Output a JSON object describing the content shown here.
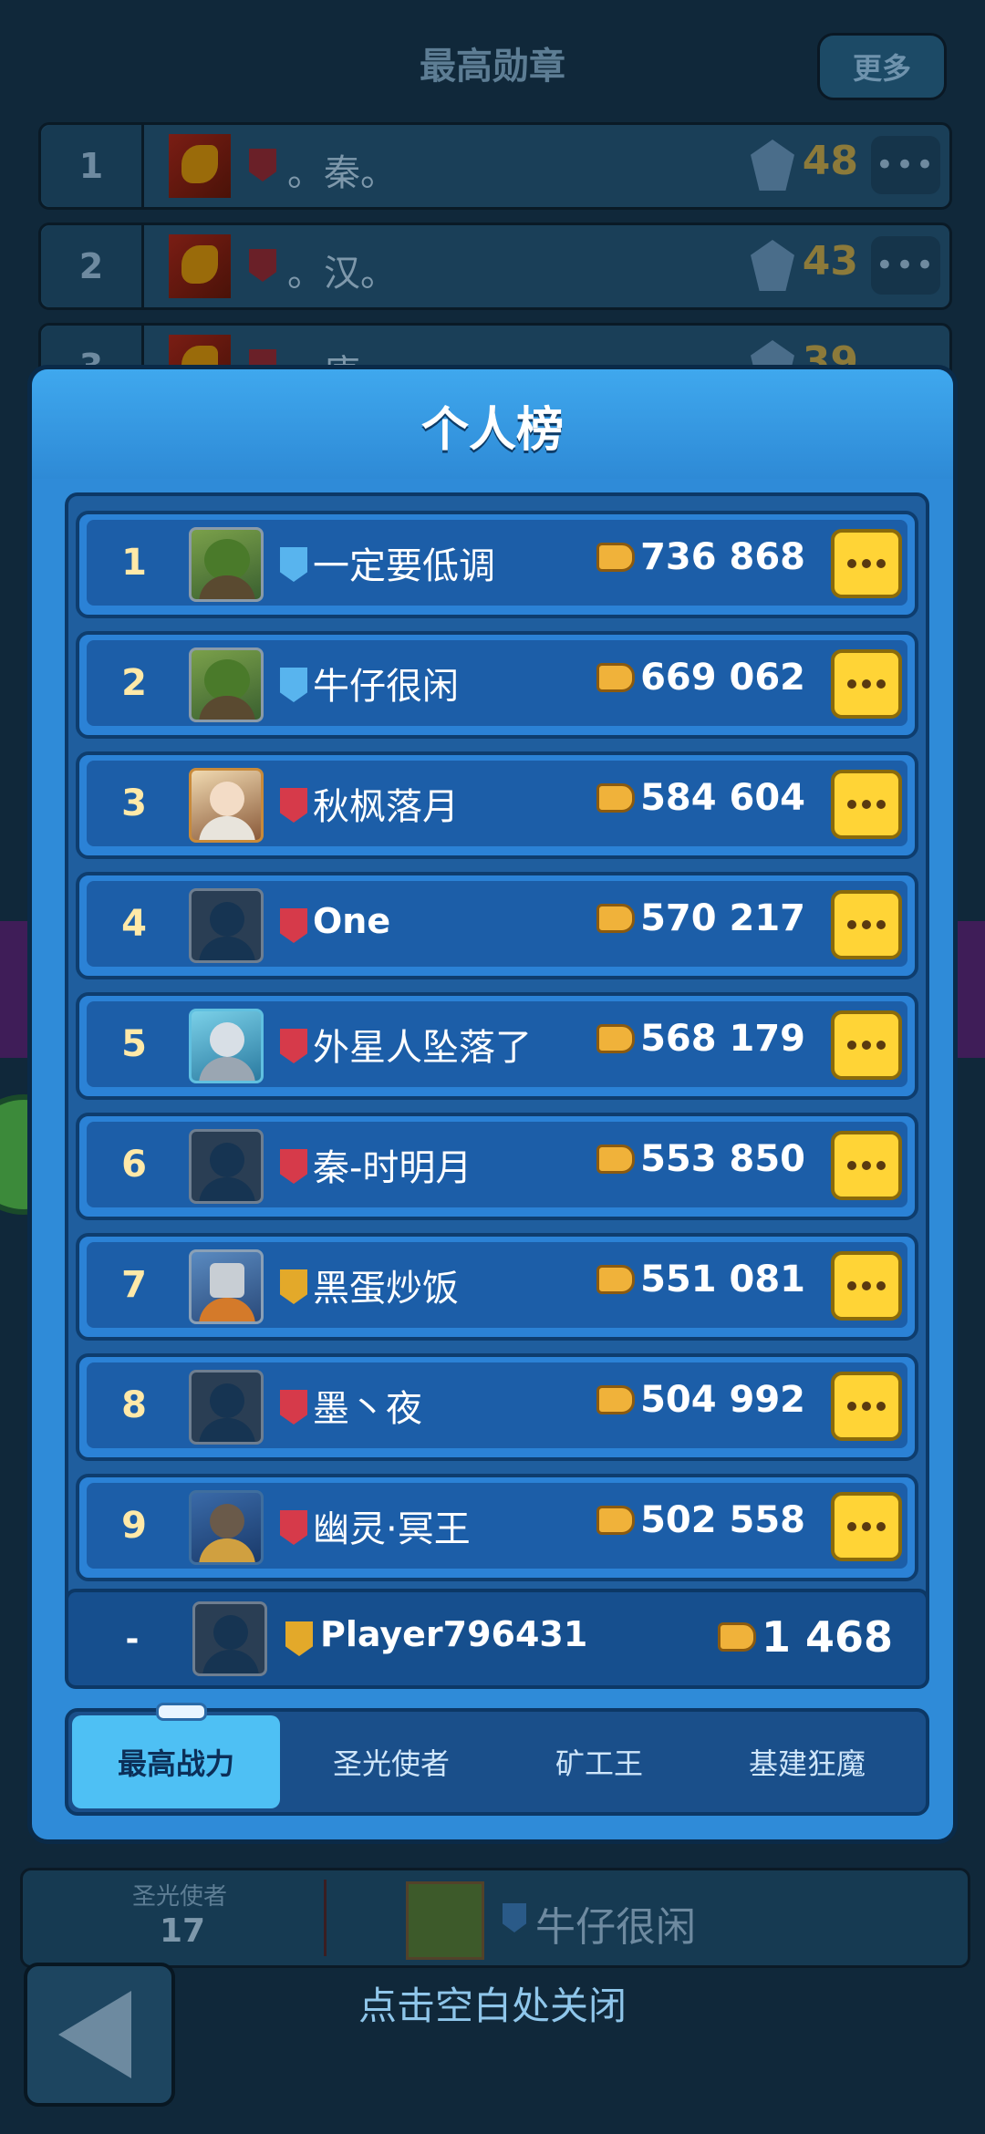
{
  "background": {
    "title": "最高勋章",
    "more_label": "更多",
    "rows": [
      {
        "rank": "1",
        "name": "。秦。",
        "score": "48"
      },
      {
        "rank": "2",
        "name": "。汉。",
        "score": "43"
      },
      {
        "rank": "3",
        "name": "。唐。",
        "score": "39"
      }
    ],
    "bottom_card": {
      "label": "圣光使者",
      "value": "17",
      "name": "牛仔很闲"
    },
    "close_hint": "点击空白处关闭"
  },
  "modal": {
    "title": "个人榜",
    "players": [
      {
        "rank": "1",
        "name": "一定要低调",
        "clan": "blue",
        "power": "736 868",
        "avatar": "goblin"
      },
      {
        "rank": "2",
        "name": "牛仔很闲",
        "clan": "blue",
        "power": "669 062",
        "avatar": "goblin"
      },
      {
        "rank": "3",
        "name": "秋枫落月",
        "clan": "red",
        "power": "584 604",
        "avatar": "girl"
      },
      {
        "rank": "4",
        "name": "One",
        "clan": "red",
        "power": "570 217",
        "avatar": "default"
      },
      {
        "rank": "5",
        "name": "外星人坠落了",
        "clan": "red",
        "power": "568 179",
        "avatar": "robot"
      },
      {
        "rank": "6",
        "name": "秦-时明月",
        "clan": "red",
        "power": "553 850",
        "avatar": "default"
      },
      {
        "rank": "7",
        "name": "黑蛋炒饭",
        "clan": "gold",
        "power": "551 081",
        "avatar": "hammer"
      },
      {
        "rank": "8",
        "name": "墨丶夜",
        "clan": "red",
        "power": "504 992",
        "avatar": "default"
      },
      {
        "rank": "9",
        "name": "幽灵·冥王",
        "clan": "red",
        "power": "502 558",
        "avatar": "wolf"
      }
    ],
    "my_row": {
      "rank": "-",
      "name": "Player796431",
      "clan": "gold",
      "power": "1 468"
    },
    "tabs": [
      {
        "label": "最高战力",
        "active": true
      },
      {
        "label": "圣光使者",
        "active": false
      },
      {
        "label": "矿工王",
        "active": false
      },
      {
        "label": "基建狂魔",
        "active": false
      }
    ]
  },
  "colors": {
    "accent": "#2f8bd8",
    "button_yellow": "#ffd436",
    "tab_active": "#4ec0f4"
  }
}
